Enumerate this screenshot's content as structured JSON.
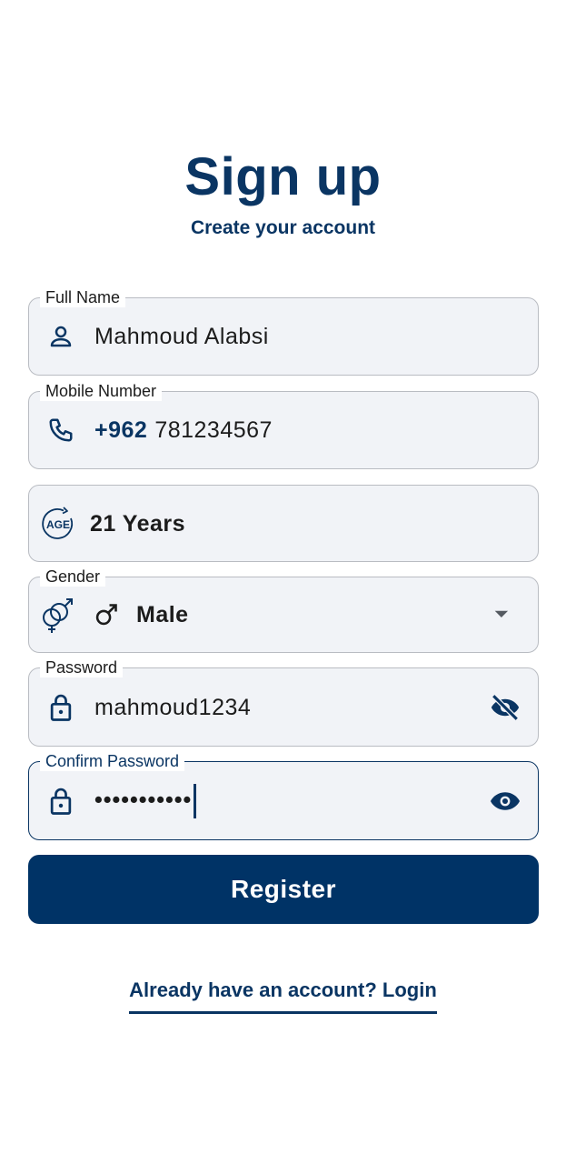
{
  "header": {
    "title": "Sign up",
    "subtitle": "Create your account"
  },
  "form": {
    "full_name": {
      "label": "Full Name",
      "value": "Mahmoud Alabsi",
      "icon": "person-icon"
    },
    "mobile": {
      "label": "Mobile Number",
      "country_code": "+962",
      "value": "781234567",
      "icon": "phone-icon"
    },
    "age": {
      "value": "21 Years",
      "icon": "age-icon"
    },
    "gender": {
      "label": "Gender",
      "value": "Male",
      "icon": "gender-icon",
      "value_icon": "male-symbol-icon",
      "trailing_icon": "dropdown-arrow-icon"
    },
    "password": {
      "label": "Password",
      "value": "mahmoud1234",
      "icon": "lock-icon",
      "trailing_icon": "eye-off-icon"
    },
    "confirm_password": {
      "label": "Confirm Password",
      "value": "•••••••••••",
      "icon": "lock-icon",
      "trailing_icon": "eye-icon",
      "focused": true
    }
  },
  "actions": {
    "register_label": "Register",
    "login_link": "Already have an account? Login"
  },
  "colors": {
    "primary": "#003366",
    "field_background": "#f1f3f7",
    "field_border": "#b9bcc2"
  }
}
